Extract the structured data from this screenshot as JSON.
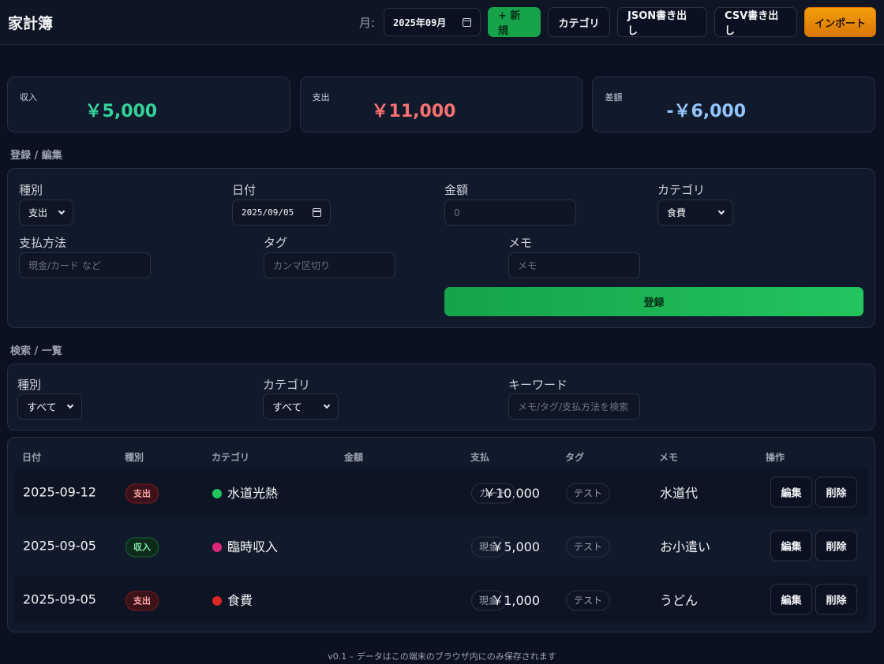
{
  "header": {
    "title": "家計簿",
    "month_label": "月:",
    "month_value": "2025年09月",
    "buttons": {
      "new": "+ 新規",
      "category": "カテゴリ",
      "json_export": "JSON書き出し",
      "csv_export": "CSV書き出し",
      "import": "インポート"
    }
  },
  "summary": {
    "income_label": "収入",
    "income_value": "￥5,000",
    "expense_label": "支出",
    "expense_value": "￥11,000",
    "diff_label": "差額",
    "diff_value": "-￥6,000"
  },
  "form": {
    "section_title": "登録 / 編集",
    "type_label": "種別",
    "type_value": "支出",
    "date_label": "日付",
    "date_value": "2025/09/05",
    "amount_label": "金額",
    "amount_placeholder": "0",
    "category_label": "カテゴリ",
    "category_value": "食費",
    "payment_label": "支払方法",
    "payment_placeholder": "現金/カード など",
    "tag_label": "タグ",
    "tag_placeholder": "カンマ区切り",
    "memo_label": "メモ",
    "memo_placeholder": "メモ",
    "submit_label": "登録"
  },
  "search": {
    "section_title": "検索 / 一覧",
    "type_label": "種別",
    "type_value": "すべて",
    "category_label": "カテゴリ",
    "category_value": "すべて",
    "keyword_label": "キーワード",
    "keyword_placeholder": "メモ/タグ/支払方法を検索"
  },
  "table": {
    "headers": [
      "日付",
      "種別",
      "カテゴリ",
      "金額",
      "支払",
      "タグ",
      "メモ",
      "操作"
    ],
    "edit_label": "編集",
    "delete_label": "削除",
    "rows": [
      {
        "date": "2025-09-12",
        "type": "支出",
        "category": "水道光熱",
        "category_color": "#22c55e",
        "amount": "￥10,000",
        "payment": "カード",
        "tag": "テスト",
        "memo": "水道代"
      },
      {
        "date": "2025-09-05",
        "type": "収入",
        "category": "臨時収入",
        "category_color": "#db2777",
        "amount": "￥5,000",
        "payment": "現金",
        "tag": "テスト",
        "memo": "お小遣い"
      },
      {
        "date": "2025-09-05",
        "type": "支出",
        "category": "食費",
        "category_color": "#dc2626",
        "amount": "￥1,000",
        "payment": "現金",
        "tag": "テスト",
        "memo": "うどん"
      }
    ]
  },
  "footer": "v0.1 – データはこの端末のブラウザ内にのみ保存されます"
}
